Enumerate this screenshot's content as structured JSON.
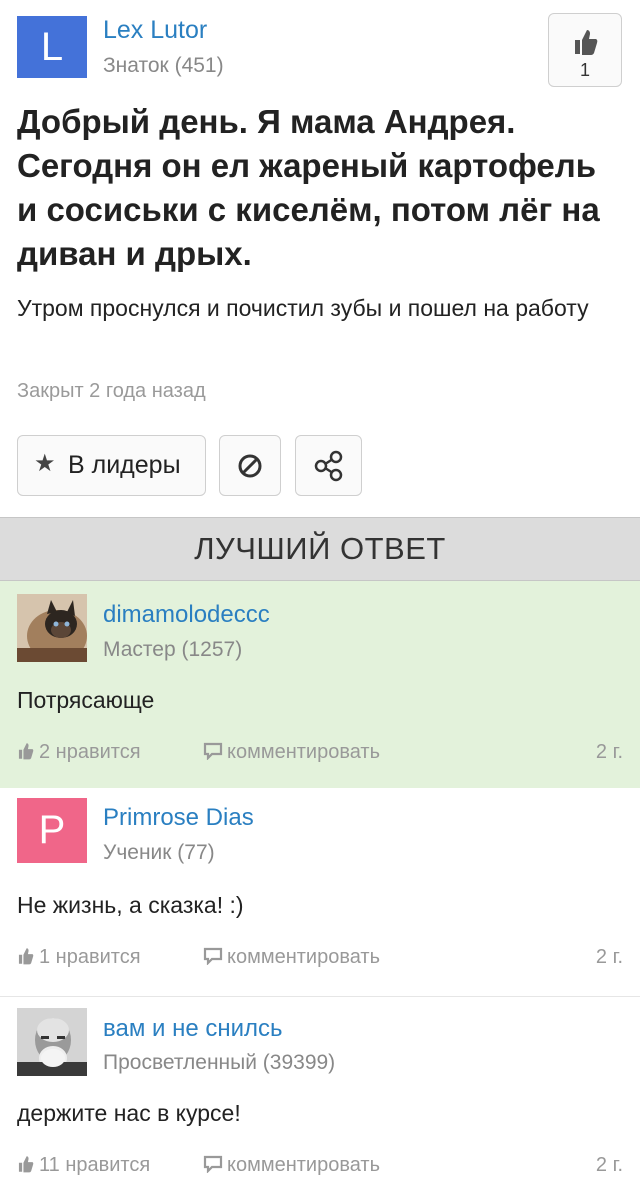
{
  "question": {
    "author": {
      "initial": "L",
      "name": "Lex Lutor",
      "rank": "Знаток (451)",
      "avatar_color": "#4472d9"
    },
    "like_count": "1",
    "title": "Добрый день. Я мама Андрея. Сегодня он ел жареный картофель и сосиськи с киселём, потом лёг на диван и дрых.",
    "body": "Утром проснулся и почистил зубы и пошел на работу",
    "status": "Закрыт 2 года назад",
    "actions": {
      "leaders_label": "В лидеры",
      "leaders_icon": "star-icon",
      "block_icon": "block-icon",
      "share_icon": "share-icon"
    }
  },
  "best_answer_header": "ЛУЧШИЙ ОТВЕТ",
  "answers": [
    {
      "name": "dimamolodeccc",
      "rank": "Мастер (1257)",
      "text": "Потрясающе",
      "likes": "2 нравится",
      "comment_label": "комментировать",
      "time": "2 г.",
      "best": true,
      "avatar": "cat-photo"
    },
    {
      "name": "Primrose Dias",
      "initial": "P",
      "avatar_color": "#f06689",
      "rank": "Ученик (77)",
      "text": "Не жизнь, а сказка! :)",
      "likes": "1 нравится",
      "comment_label": "комментировать",
      "time": "2 г.",
      "best": false
    },
    {
      "name": "вам и не снилсь",
      "rank": "Просветленный (39399)",
      "text": "держите нас в курсе!",
      "likes": "11 нравится",
      "comment_label": "комментировать",
      "time": "2 г.",
      "best": false,
      "avatar": "bearded-man-photo"
    }
  ],
  "colors": {
    "link": "#2a7fc1",
    "best_bg": "#e3f2db",
    "header_bg": "#dcdcdc"
  }
}
